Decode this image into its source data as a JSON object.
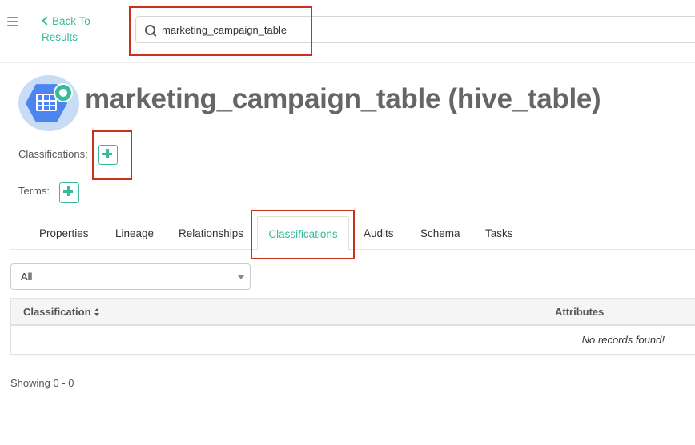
{
  "header": {
    "menu_icon": "hamburger-icon",
    "back_label": "Back To Results",
    "back_icon": "chevron-left-icon",
    "search": {
      "value": "marketing_campaign_table",
      "icon": "search-icon"
    }
  },
  "entity": {
    "title": "marketing_campaign_table (hive_table)",
    "icon": "hive-table-icon",
    "classifications_label": "Classifications:",
    "terms_label": "Terms:"
  },
  "tabs": [
    {
      "label": "Properties"
    },
    {
      "label": "Lineage"
    },
    {
      "label": "Relationships"
    },
    {
      "label": "Classifications",
      "active": true
    },
    {
      "label": "Audits"
    },
    {
      "label": "Schema"
    },
    {
      "label": "Tasks"
    }
  ],
  "filter": {
    "selected": "All"
  },
  "table": {
    "columns": [
      "Classification",
      "Attributes"
    ],
    "empty_message": "No records found!"
  },
  "pagination": {
    "showing": "Showing 0 - 0"
  },
  "colors": {
    "accent": "#37bb9b",
    "highlight": "#c8321c",
    "title": "#666666"
  }
}
